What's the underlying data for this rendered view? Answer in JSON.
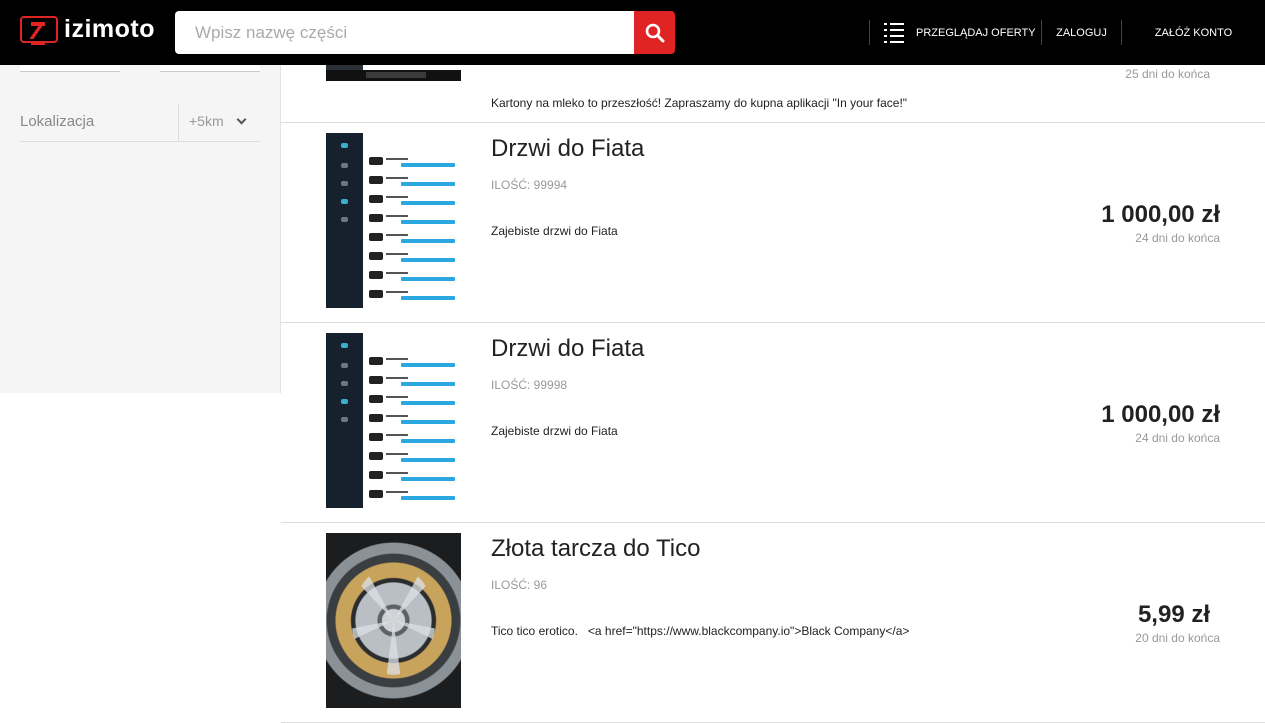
{
  "header": {
    "logo_text": "izimoto",
    "search_placeholder": "Wpisz nazwę części",
    "nav_browse": "PRZEGLĄDAJ OFERTY",
    "nav_login": "ZALOGUJ",
    "nav_register": "ZAŁÓŻ KONTO"
  },
  "sidebar": {
    "location_label": "Lokalizacja",
    "radius_value": "+5km"
  },
  "items": [
    {
      "days_left": "25 dni do końca",
      "description": "Kartony na mleko to przeszłość! Zapraszamy do kupna aplikacji \"In your face!\""
    },
    {
      "title": "Drzwi do Fiata",
      "quantity": "ILOŚĆ: 99994",
      "description": "Zajebiste drzwi do Fiata",
      "price": "1 000,00 zł",
      "days_left": "24 dni do końca"
    },
    {
      "title": "Drzwi do Fiata",
      "quantity": "ILOŚĆ: 99998",
      "description": "Zajebiste drzwi do Fiata",
      "price": "1 000,00 zł",
      "days_left": "24 dni do końca"
    },
    {
      "title": "Złota tarcza do Tico",
      "quantity": "ILOŚĆ: 96",
      "description": "Tico tico erotico.   <a href=\"https://www.blackcompany.io\">Black Company</a>",
      "price": "5,99 zł",
      "days_left": "20 dni do końca"
    }
  ],
  "colors": {
    "brand_red": "#e02424",
    "header_bg": "#000000",
    "sidebar_bg": "#f5f5f5"
  }
}
